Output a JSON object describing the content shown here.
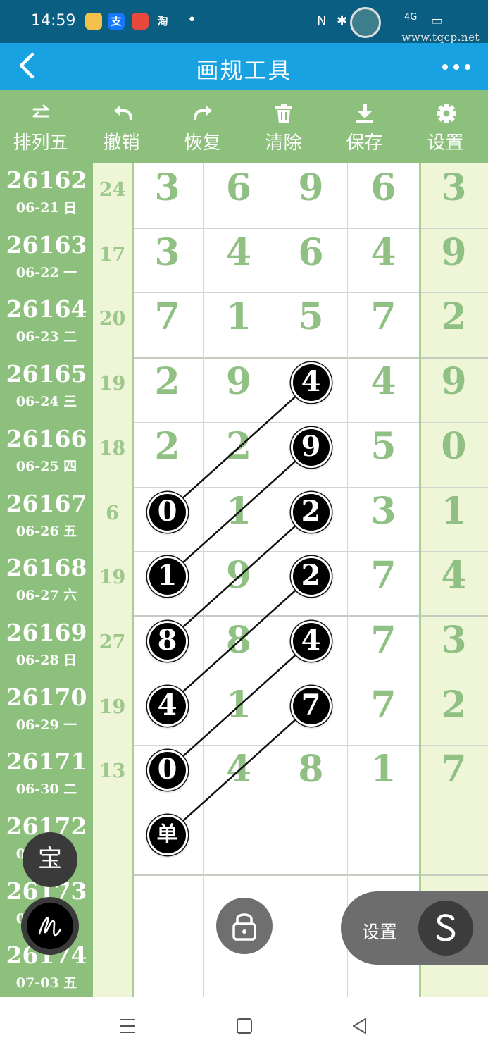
{
  "status_bar": {
    "time": "14:59",
    "app_icons": [
      "支",
      "淘"
    ],
    "right_text": "4G",
    "watermark": "www.tqcp.net"
  },
  "title_bar": {
    "title": "画规工具"
  },
  "toolbar": {
    "items": [
      {
        "label": "排列五",
        "icon": "swap-icon"
      },
      {
        "label": "撤销",
        "icon": "undo-icon"
      },
      {
        "label": "恢复",
        "icon": "redo-icon"
      },
      {
        "label": "清除",
        "icon": "trash-icon"
      },
      {
        "label": "保存",
        "icon": "download-icon"
      },
      {
        "label": "设置",
        "icon": "gear-icon"
      }
    ]
  },
  "rows": [
    {
      "issue": "26162",
      "date": "06-21 日",
      "sum": "24",
      "digits": [
        "3",
        "6",
        "9",
        "6",
        "3"
      ]
    },
    {
      "issue": "26163",
      "date": "06-22 一",
      "sum": "17",
      "digits": [
        "3",
        "4",
        "6",
        "4",
        "9"
      ]
    },
    {
      "issue": "26164",
      "date": "06-23 二",
      "sum": "20",
      "digits": [
        "7",
        "1",
        "5",
        "7",
        "2"
      ]
    },
    {
      "issue": "26165",
      "date": "06-24 三",
      "sum": "19",
      "digits": [
        "2",
        "9",
        "4",
        "4",
        "9"
      ]
    },
    {
      "issue": "26166",
      "date": "06-25 四",
      "sum": "18",
      "digits": [
        "2",
        "2",
        "9",
        "5",
        "0"
      ]
    },
    {
      "issue": "26167",
      "date": "06-26 五",
      "sum": "6",
      "digits": [
        "0",
        "1",
        "2",
        "3",
        "1"
      ]
    },
    {
      "issue": "26168",
      "date": "06-27 六",
      "sum": "19",
      "digits": [
        "1",
        "9",
        "2",
        "7",
        "4"
      ]
    },
    {
      "issue": "26169",
      "date": "06-28 日",
      "sum": "27",
      "digits": [
        "8",
        "8",
        "4",
        "7",
        "3"
      ]
    },
    {
      "issue": "26170",
      "date": "06-29 一",
      "sum": "19",
      "digits": [
        "4",
        "1",
        "7",
        "7",
        "2"
      ]
    },
    {
      "issue": "26171",
      "date": "06-30 二",
      "sum": "13",
      "digits": [
        "0",
        "4",
        "8",
        "1",
        "7"
      ]
    },
    {
      "issue": "26172",
      "date": "07-01 三",
      "sum": "",
      "digits": [
        "",
        "",
        "",
        "",
        ""
      ]
    },
    {
      "issue": "26173",
      "date": "07-02 四",
      "sum": "",
      "digits": [
        "",
        "",
        "",
        "",
        ""
      ]
    },
    {
      "issue": "26174",
      "date": "07-03 五",
      "sum": "",
      "digits": [
        "",
        "",
        "",
        "",
        ""
      ]
    }
  ],
  "marks": [
    {
      "row": 3,
      "col": 2,
      "text": "4"
    },
    {
      "row": 4,
      "col": 2,
      "text": "9"
    },
    {
      "row": 5,
      "col": 0,
      "text": "0"
    },
    {
      "row": 5,
      "col": 2,
      "text": "2"
    },
    {
      "row": 6,
      "col": 0,
      "text": "1"
    },
    {
      "row": 6,
      "col": 2,
      "text": "2"
    },
    {
      "row": 7,
      "col": 0,
      "text": "8"
    },
    {
      "row": 7,
      "col": 2,
      "text": "4"
    },
    {
      "row": 8,
      "col": 0,
      "text": "4"
    },
    {
      "row": 8,
      "col": 2,
      "text": "7"
    },
    {
      "row": 9,
      "col": 0,
      "text": "0"
    },
    {
      "row": 10,
      "col": 0,
      "text": "单"
    }
  ],
  "links": [
    [
      0,
      2
    ],
    [
      1,
      4
    ],
    [
      3,
      6
    ],
    [
      5,
      8
    ],
    [
      7,
      10
    ],
    [
      9,
      11
    ]
  ],
  "floating": {
    "bao_label": "宝",
    "settings_label": "设置"
  },
  "colors": {
    "green": "#8ec07d",
    "digit": "#90c083",
    "pale": "#eef6d7",
    "titlebar": "#19a2e2"
  }
}
